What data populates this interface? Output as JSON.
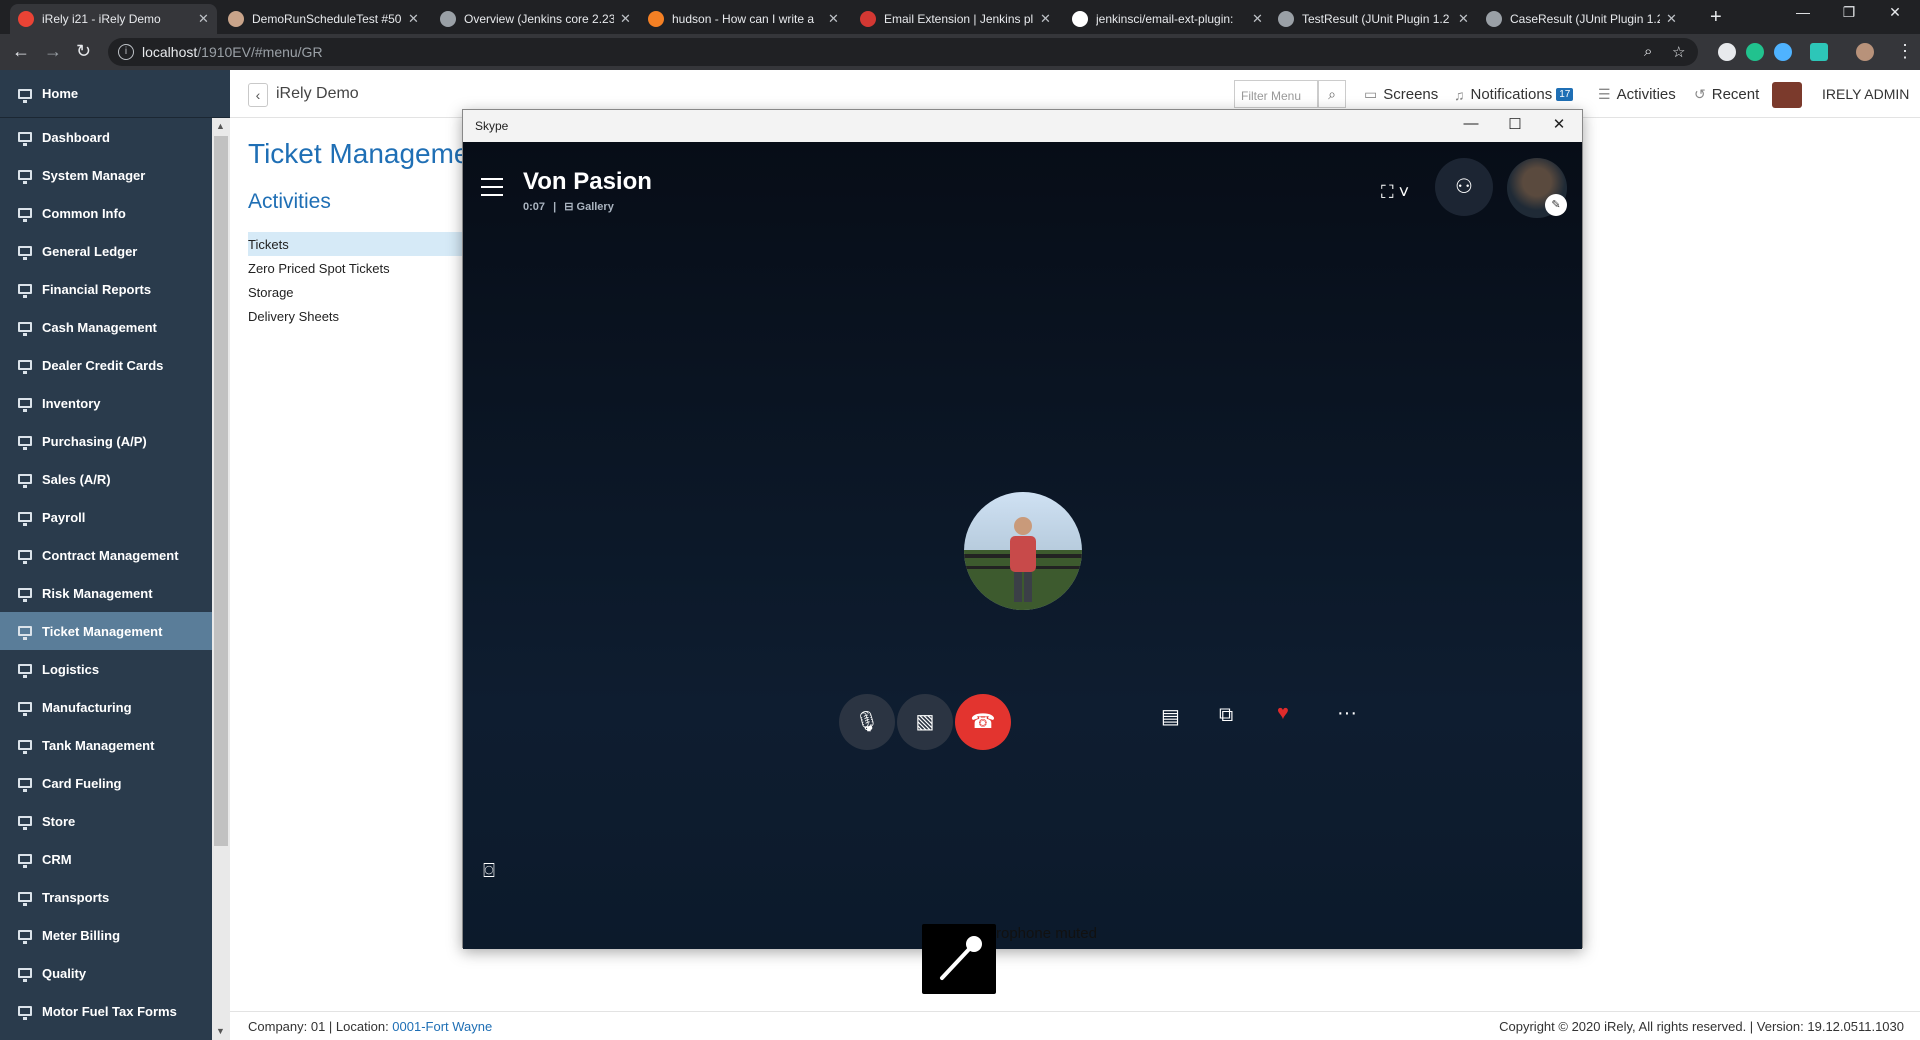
{
  "browser": {
    "tabs": [
      {
        "title": "iRely i21 - iRely Demo",
        "active": true,
        "favicon_color": "#ea4335"
      },
      {
        "title": "DemoRunScheduleTest #50",
        "active": false,
        "favicon_color": "#c9a48a"
      },
      {
        "title": "Overview (Jenkins core 2.23",
        "active": false,
        "favicon_color": "#9aa0a6"
      },
      {
        "title": "hudson - How can I write a",
        "active": false,
        "favicon_color": "#f48024"
      },
      {
        "title": "Email Extension | Jenkins pl",
        "active": false,
        "favicon_color": "#d33833"
      },
      {
        "title": "jenkinsci/email-ext-plugin:",
        "active": false,
        "favicon_color": "#ffffff"
      },
      {
        "title": "TestResult (JUnit Plugin 1.2",
        "active": false,
        "favicon_color": "#9aa0a6"
      },
      {
        "title": "CaseResult (JUnit Plugin 1.2",
        "active": false,
        "favicon_color": "#9aa0a6"
      }
    ],
    "url_host": "localhost",
    "url_path": "/1910EV/#menu/GR"
  },
  "app": {
    "title": "iRely Demo",
    "filter_placeholder": "Filter Menu",
    "screens_label": "Screens",
    "notifications_label": "Notifications",
    "notifications_count": "17",
    "activities_label": "Activities",
    "recent_label": "Recent",
    "user_name": "IRELY ADMIN"
  },
  "sidebar": {
    "home_label": "Home",
    "items": [
      {
        "label": "Dashboard"
      },
      {
        "label": "System Manager"
      },
      {
        "label": "Common Info"
      },
      {
        "label": "General Ledger"
      },
      {
        "label": "Financial Reports"
      },
      {
        "label": "Cash Management"
      },
      {
        "label": "Dealer Credit Cards"
      },
      {
        "label": "Inventory"
      },
      {
        "label": "Purchasing (A/P)"
      },
      {
        "label": "Sales (A/R)"
      },
      {
        "label": "Payroll"
      },
      {
        "label": "Contract Management"
      },
      {
        "label": "Risk Management"
      },
      {
        "label": "Ticket Management",
        "active": true
      },
      {
        "label": "Logistics"
      },
      {
        "label": "Manufacturing"
      },
      {
        "label": "Tank Management"
      },
      {
        "label": "Card Fueling"
      },
      {
        "label": "Store"
      },
      {
        "label": "CRM"
      },
      {
        "label": "Transports"
      },
      {
        "label": "Meter Billing"
      },
      {
        "label": "Quality"
      },
      {
        "label": "Motor Fuel Tax Forms"
      }
    ]
  },
  "content": {
    "page_title": "Ticket Manageme",
    "section_title": "Activities",
    "activities": [
      "Tickets",
      "Zero Priced Spot Tickets",
      "Storage",
      "Delivery Sheets"
    ]
  },
  "footer": {
    "company_prefix": "Company: 01 | Location: ",
    "location_link": "0001-Fort Wayne",
    "copyright": "Copyright © 2020 iRely, All rights reserved. | Version: 19.12.0511.1030"
  },
  "skype": {
    "window_title": "Skype",
    "caller_name": "Von Pasion",
    "duration": "0:07",
    "view_mode": "Gallery",
    "muted_notice": "rophone muted"
  }
}
